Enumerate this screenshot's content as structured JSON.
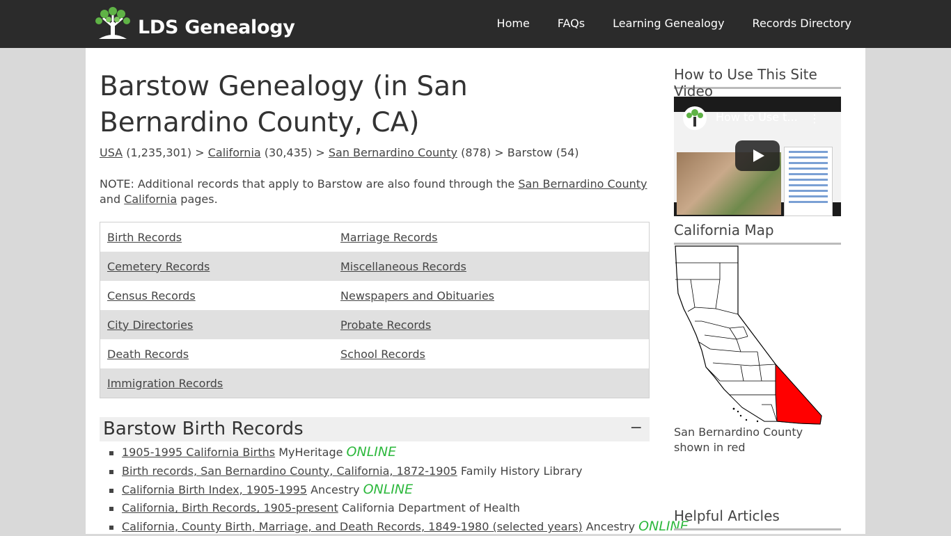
{
  "site": {
    "name": "LDS Genealogy"
  },
  "nav": [
    "Home",
    "FAQs",
    "Learning Genealogy",
    "Records Directory"
  ],
  "page": {
    "title": "Barstow Genealogy (in San Bernardino County, CA)",
    "breadcrumb": {
      "usa": "USA",
      "usa_count": "(1,235,301)",
      "california": "California",
      "california_count": "(30,435)",
      "county": "San Bernardino County",
      "county_count": "(878)",
      "current": "Barstow (54)",
      "sep": ">"
    },
    "note": {
      "prefix": "NOTE: Additional records that apply to Barstow are also found through the",
      "link1": "San Bernardino County",
      "middle": "and",
      "link2": "California",
      "suffix": "pages."
    }
  },
  "categories": [
    [
      "Birth Records",
      "Marriage Records"
    ],
    [
      "Cemetery Records",
      "Miscellaneous Records"
    ],
    [
      "Census Records",
      "Newspapers and Obituaries"
    ],
    [
      "City Directories",
      "Probate Records"
    ],
    [
      "Death Records",
      "School Records"
    ],
    [
      "Immigration Records",
      ""
    ]
  ],
  "birth_section": {
    "title": "Barstow Birth Records",
    "toggle": "−",
    "items": [
      {
        "link": "1905-1995 California Births",
        "source": "MyHeritage",
        "online": "ONLINE"
      },
      {
        "link": "Birth records, San Bernardino County, California, 1872-1905",
        "source": "Family History Library",
        "online": ""
      },
      {
        "link": "California Birth Index, 1905-1995",
        "source": "Ancestry",
        "online": "ONLINE"
      },
      {
        "link": "California, Birth Records, 1905-present",
        "source": "California Department of Health",
        "online": ""
      },
      {
        "link": "California, County Birth, Marriage, and Death Records, 1849-1980 (selected years)",
        "source": "Ancestry",
        "online": "ONLINE"
      }
    ]
  },
  "sidebar": {
    "video_heading": "How to Use This Site Video",
    "video_title": "How to Use t...",
    "map_heading": "California Map",
    "map_caption": "San Bernardino County shown in red",
    "help_heading": "Helpful Articles"
  },
  "colors": {
    "header": "#2b2b2b",
    "online": "#2db83d",
    "highlight_county": "#ff0000"
  }
}
